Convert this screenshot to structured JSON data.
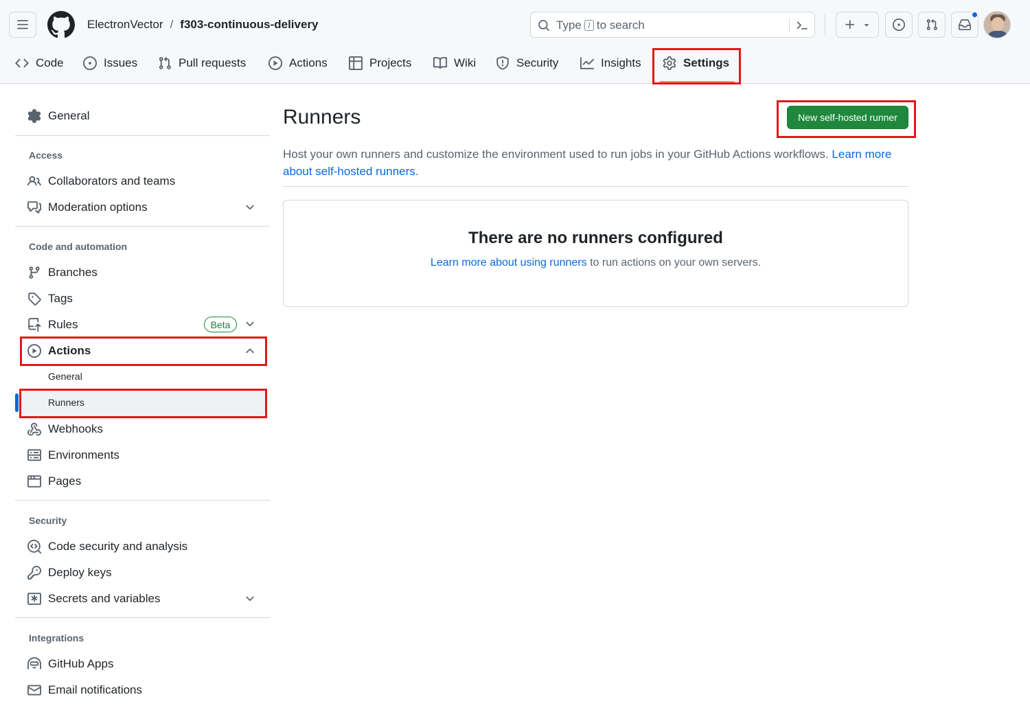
{
  "header": {
    "owner": "ElectronVector",
    "separator": "/",
    "repo": "f303-continuous-delivery",
    "search": {
      "prefix": "Type",
      "key": "/",
      "suffix": "to search"
    }
  },
  "tabs": [
    {
      "label": "Code",
      "icon": "code-icon"
    },
    {
      "label": "Issues",
      "icon": "issue-icon"
    },
    {
      "label": "Pull requests",
      "icon": "pull-request-icon"
    },
    {
      "label": "Actions",
      "icon": "play-icon"
    },
    {
      "label": "Projects",
      "icon": "table-icon"
    },
    {
      "label": "Wiki",
      "icon": "book-icon"
    },
    {
      "label": "Security",
      "icon": "shield-icon"
    },
    {
      "label": "Insights",
      "icon": "graph-icon"
    },
    {
      "label": "Settings",
      "icon": "gear-icon",
      "active": true
    }
  ],
  "sidebar": {
    "general": "General",
    "sections": {
      "access": "Access",
      "code_automation": "Code and automation",
      "security": "Security",
      "integrations": "Integrations"
    },
    "items": {
      "collaborators": "Collaborators and teams",
      "moderation": "Moderation options",
      "branches": "Branches",
      "tags": "Tags",
      "rules": "Rules",
      "rules_badge": "Beta",
      "actions": "Actions",
      "actions_general": "General",
      "actions_runners": "Runners",
      "webhooks": "Webhooks",
      "environments": "Environments",
      "pages": "Pages",
      "code_security": "Code security and analysis",
      "deploy_keys": "Deploy keys",
      "secrets": "Secrets and variables",
      "github_apps": "GitHub Apps",
      "email_notifications": "Email notifications"
    }
  },
  "main": {
    "title": "Runners",
    "new_button": "New self-hosted runner",
    "description": "Host your own runners and customize the environment used to run jobs in your GitHub Actions workflows.",
    "description_link": "Learn more about self-hosted runners",
    "description_end": ".",
    "empty_title": "There are no runners configured",
    "empty_link": "Learn more about using runners",
    "empty_rest": " to run actions on your own servers."
  },
  "colors": {
    "accent_green": "#1f883d",
    "link_blue": "#0969da",
    "highlight_red": "#e4161b",
    "tab_underline": "#fd8c73",
    "notification_dot": "#0969da"
  }
}
